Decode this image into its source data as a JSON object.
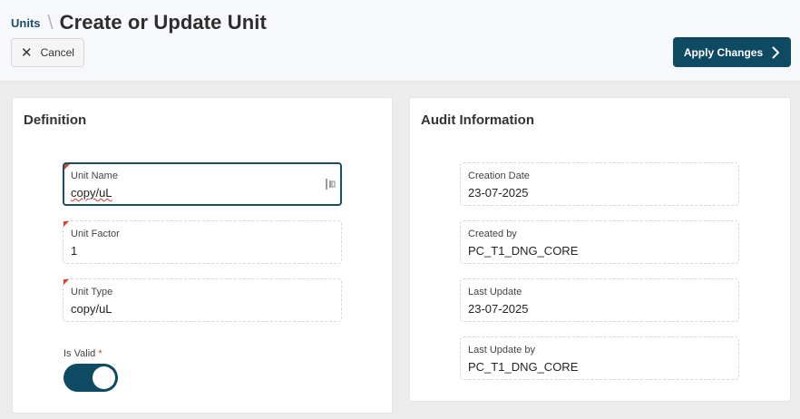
{
  "header": {
    "breadcrumb_link": "Units",
    "breadcrumb_sep": "\\",
    "title": "Create or Update Unit",
    "cancel_label": "Cancel",
    "apply_label": "Apply Changes"
  },
  "definition": {
    "title": "Definition",
    "fields": [
      {
        "label": "Unit Name",
        "value": "copy/uL",
        "required": true,
        "focused": true
      },
      {
        "label": "Unit Factor",
        "value": "1",
        "required": true
      },
      {
        "label": "Unit Type",
        "value": "copy/uL",
        "required": true
      }
    ],
    "is_valid": {
      "label": "Is Valid",
      "required_mark": "*",
      "checked": true
    }
  },
  "audit": {
    "title": "Audit Information",
    "fields": [
      {
        "label": "Creation Date",
        "value": "23-07-2025"
      },
      {
        "label": "Created by",
        "value": "PC_T1_DNG_CORE"
      },
      {
        "label": "Last Update",
        "value": "23-07-2025"
      },
      {
        "label": "Last Update by",
        "value": "PC_T1_DNG_CORE"
      }
    ]
  },
  "colors": {
    "primary": "#0f4a63",
    "link": "#1a4f6e",
    "required": "#d6452c"
  },
  "icons": {
    "cancel": "close-icon",
    "apply": "chevron-right-icon",
    "field_action": "field-action-icon"
  }
}
